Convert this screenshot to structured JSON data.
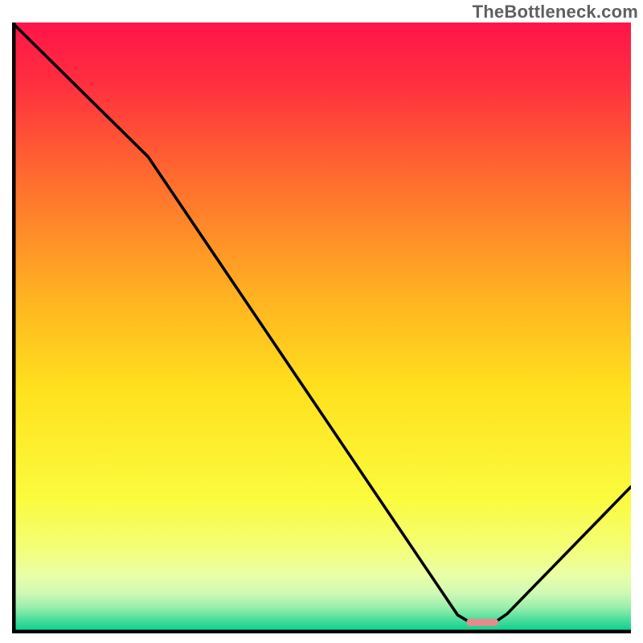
{
  "watermark": "TheBottleneck.com",
  "chart_data": {
    "type": "line",
    "title": "",
    "xlabel": "",
    "ylabel": "",
    "xlim": [
      0,
      100
    ],
    "ylim": [
      0,
      100
    ],
    "grid": false,
    "legend": false,
    "annotations": [],
    "series": [
      {
        "name": "bottleneck-curve",
        "x": [
          0,
          22,
          72,
          74,
          78,
          80,
          100
        ],
        "values": [
          100,
          78,
          3,
          1.8,
          1.8,
          3.2,
          24
        ]
      }
    ],
    "marker": {
      "name": "highlight-segment",
      "x_start": 74,
      "x_end": 78,
      "y": 1.8,
      "color": "#e58b8b"
    },
    "gradient_stops": [
      {
        "offset": 0.0,
        "color": "#ff1549"
      },
      {
        "offset": 0.1,
        "color": "#ff2f3f"
      },
      {
        "offset": 0.25,
        "color": "#ff6a2f"
      },
      {
        "offset": 0.45,
        "color": "#ffb321"
      },
      {
        "offset": 0.6,
        "color": "#ffe11e"
      },
      {
        "offset": 0.78,
        "color": "#fbfb3e"
      },
      {
        "offset": 0.86,
        "color": "#f4fe77"
      },
      {
        "offset": 0.905,
        "color": "#eaffa6"
      },
      {
        "offset": 0.935,
        "color": "#cef9b4"
      },
      {
        "offset": 0.958,
        "color": "#97eeab"
      },
      {
        "offset": 0.975,
        "color": "#55e09e"
      },
      {
        "offset": 0.99,
        "color": "#1fd492"
      },
      {
        "offset": 1.0,
        "color": "#10cf8c"
      }
    ],
    "axis_color": "#000000",
    "axis_width": 4.5,
    "curve_color": "#000000",
    "curve_width": 3.6,
    "marker_width": 9
  }
}
